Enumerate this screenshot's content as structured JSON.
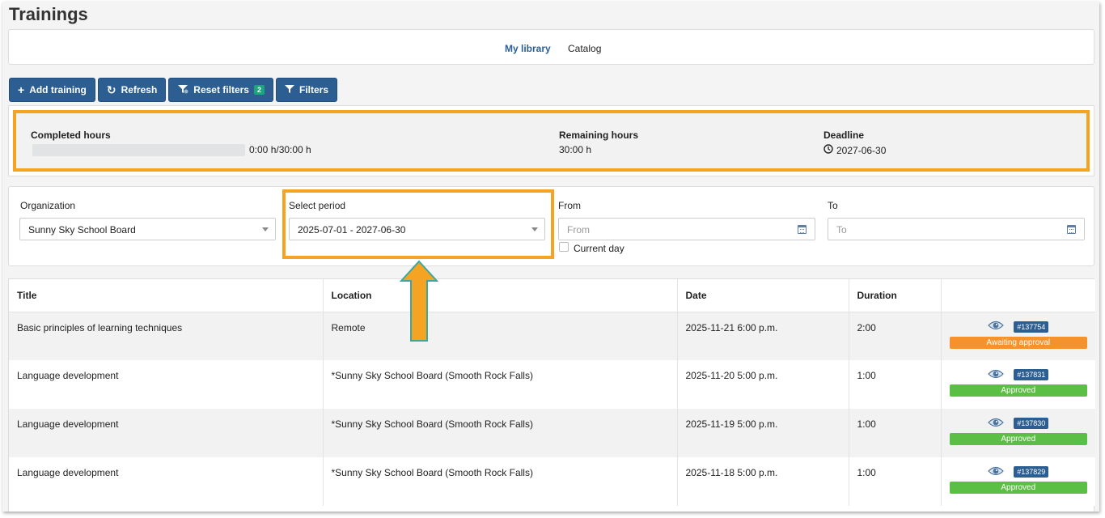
{
  "page": {
    "title": "Trainings"
  },
  "tabs": [
    {
      "label": "My library",
      "active": true
    },
    {
      "label": "Catalog",
      "active": false
    }
  ],
  "toolbar": {
    "add_label": "Add training",
    "refresh_label": "Refresh",
    "reset_label": "Reset filters",
    "reset_count": "2",
    "filters_label": "Filters"
  },
  "summary": {
    "completed_label": "Completed hours",
    "completed_value": "0:00 h/30:00 h",
    "completed_fraction": 0,
    "remaining_label": "Remaining hours",
    "remaining_value": "30:00 h",
    "deadline_label": "Deadline",
    "deadline_value": "2027-06-30"
  },
  "filters": {
    "organization_label": "Organization",
    "organization_value": "Sunny Sky School Board",
    "period_label": "Select period",
    "period_value": "2025-07-01 - 2027-06-30",
    "from_label": "From",
    "from_placeholder": "From",
    "to_label": "To",
    "to_placeholder": "To",
    "current_day_label": "Current day"
  },
  "table": {
    "columns": [
      "Title",
      "Location",
      "Date",
      "Duration",
      ""
    ],
    "rows": [
      {
        "title": "Basic principles of learning techniques",
        "location": "Remote",
        "date": "2025-11-21 6:00 p.m.",
        "duration": "2:00",
        "id": "#137754",
        "status": "Awaiting approval"
      },
      {
        "title": "Language development",
        "location": "*Sunny Sky School Board (Smooth Rock Falls)",
        "date": "2025-11-20 5:00 p.m.",
        "duration": "1:00",
        "id": "#137831",
        "status": "Approved"
      },
      {
        "title": "Language development",
        "location": "*Sunny Sky School Board (Smooth Rock Falls)",
        "date": "2025-11-19 5:00 p.m.",
        "duration": "1:00",
        "id": "#137830",
        "status": "Approved"
      },
      {
        "title": "Language development",
        "location": "*Sunny Sky School Board (Smooth Rock Falls)",
        "date": "2025-11-18 5:00 p.m.",
        "duration": "1:00",
        "id": "#137829",
        "status": "Approved"
      }
    ]
  },
  "colors": {
    "primary": "#2c5e91",
    "highlight": "#f5a323",
    "awaiting": "#f5922b",
    "approved": "#5cbf45",
    "badge": "#1ea57a"
  },
  "icons": {
    "add": "plus-icon",
    "refresh": "refresh-icon",
    "reset": "reset-filter-icon",
    "filters": "filter-icon",
    "deadline": "clock-icon",
    "view": "eye-icon",
    "calendar": "calendar-icon"
  }
}
